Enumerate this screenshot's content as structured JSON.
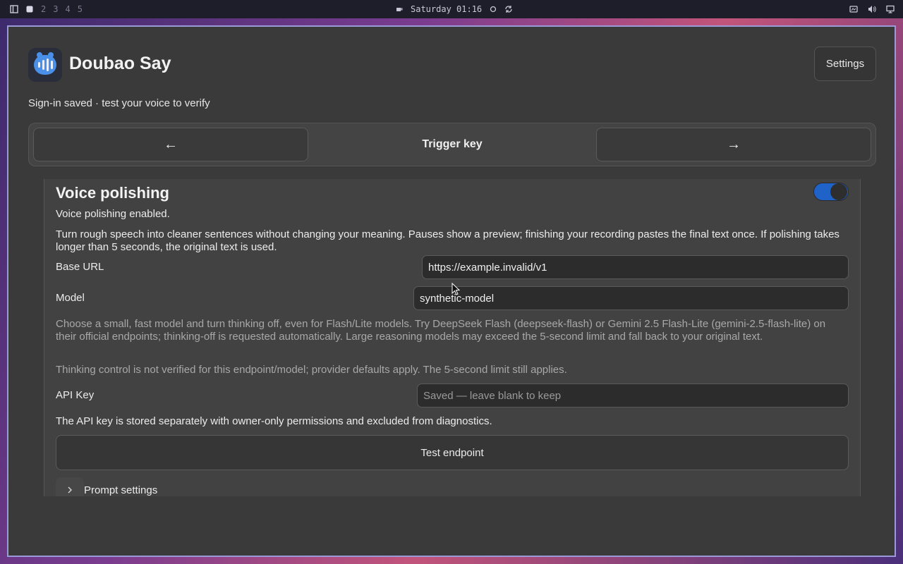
{
  "topbar": {
    "workspaces": [
      "2",
      "3",
      "4",
      "5"
    ],
    "clock": "Saturday 01:16"
  },
  "app": {
    "title": "Doubao Say",
    "settings_label": "Settings",
    "status": "Sign-in saved · test your voice to verify"
  },
  "nav": {
    "prev_label": "←",
    "next_label": "→",
    "title": "Trigger key"
  },
  "section": {
    "title": "Voice polishing",
    "toggle_on": true,
    "enabled_text": "Voice polishing enabled.",
    "description": "Turn rough speech into cleaner sentences without changing your meaning. Pauses show a preview; finishing your recording pastes the final text once. If polishing takes longer than 5 seconds, the original text is used.",
    "base_url_label": "Base URL",
    "base_url_value": "https://example.invalid/v1",
    "model_label": "Model",
    "model_value": "synthetic-model",
    "model_hint": "Choose a small, fast model and turn thinking off, even for Flash/Lite models. Try DeepSeek Flash (deepseek-flash) or Gemini 2.5 Flash-Lite (gemini-2.5-flash-lite) on their official endpoints; thinking-off is requested automatically. Large reasoning models may exceed the 5-second limit and fall back to your original text.",
    "thinking_note": "Thinking control is not verified for this endpoint/model; provider defaults apply. The 5-second limit still applies.",
    "api_key_label": "API Key",
    "api_key_placeholder": "Saved — leave blank to keep",
    "api_key_note": "The API key is stored separately with owner-only permissions and excluded from diagnostics.",
    "test_button": "Test endpoint",
    "prompt_settings": "Prompt settings"
  },
  "colors": {
    "accent": "#1f62c8",
    "window_border": "#9a9ad8"
  }
}
